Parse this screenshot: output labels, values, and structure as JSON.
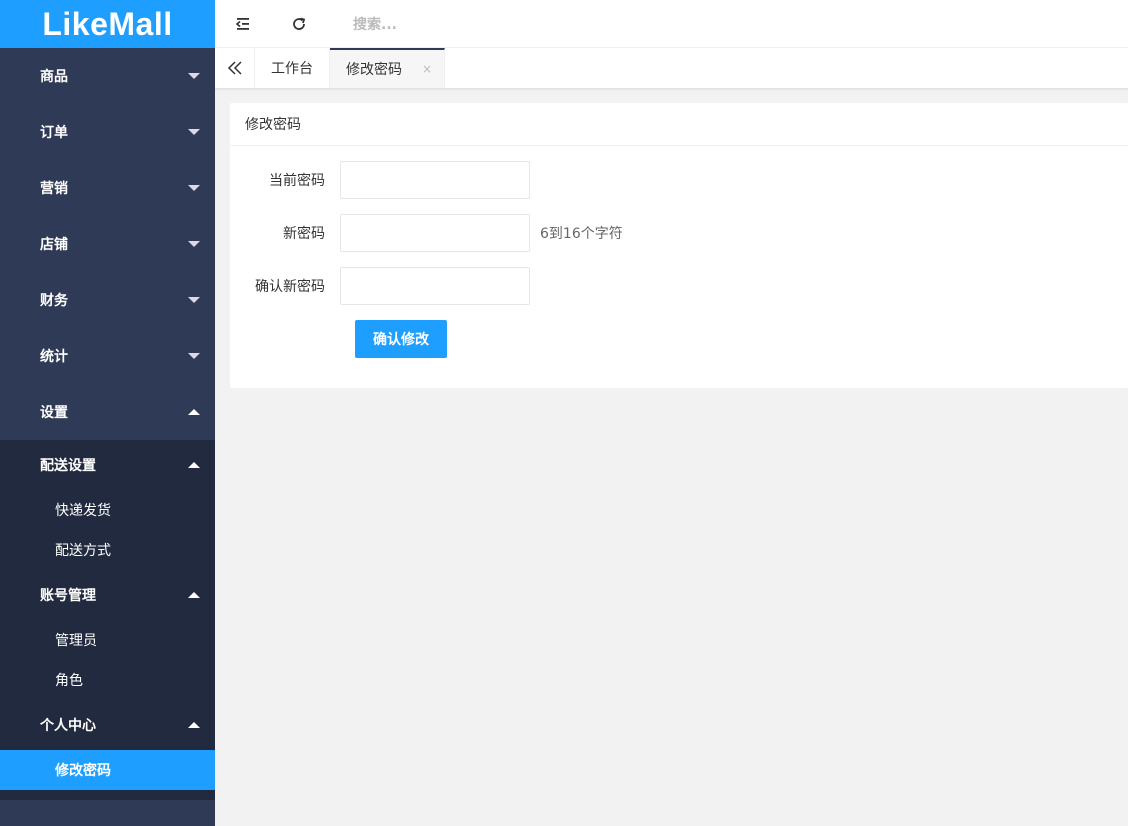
{
  "logo": {
    "text": "LikeMall"
  },
  "sidebar": {
    "menu": [
      {
        "label": "商品"
      },
      {
        "label": "订单"
      },
      {
        "label": "营销"
      },
      {
        "label": "店铺"
      },
      {
        "label": "财务"
      },
      {
        "label": "统计"
      },
      {
        "label": "设置"
      }
    ],
    "settings": {
      "groups": [
        {
          "label": "配送设置",
          "items": [
            "快递发货",
            "配送方式"
          ]
        },
        {
          "label": "账号管理",
          "items": [
            "管理员",
            "角色"
          ]
        },
        {
          "label": "个人中心",
          "items": [
            "修改密码"
          ]
        }
      ]
    }
  },
  "header": {
    "icons": [
      "collapse-menu-icon",
      "refresh-icon"
    ],
    "search_placeholder": "搜索..."
  },
  "tabs": {
    "items": [
      {
        "label": "工作台"
      },
      {
        "label": "修改密码",
        "close": "×"
      }
    ]
  },
  "form": {
    "title": "修改密码",
    "fields": [
      {
        "label": "当前密码",
        "value": ""
      },
      {
        "label": "新密码",
        "value": "",
        "hint": "6到16个字符"
      },
      {
        "label": "确认新密码",
        "value": ""
      }
    ],
    "submit_label": "确认修改"
  },
  "colors": {
    "brand": "#1e9fff",
    "sidebar_bg": "#2f3a56",
    "submenu_bg": "#212a3e"
  }
}
